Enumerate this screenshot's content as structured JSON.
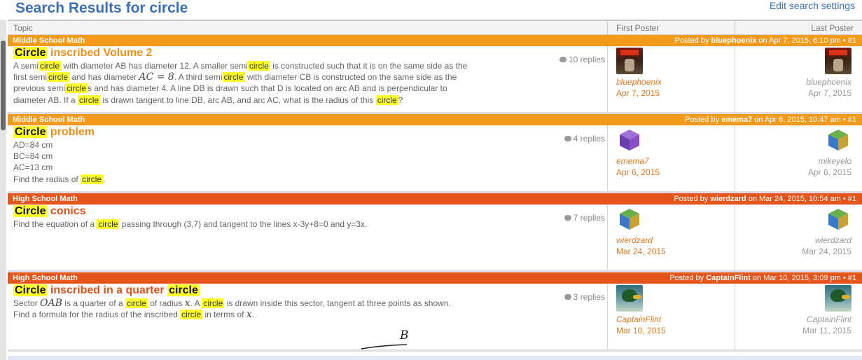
{
  "page": {
    "title": "Search Results for circle",
    "edit_link": "Edit search settings"
  },
  "columns": {
    "topic": "Topic",
    "first_poster": "First Poster",
    "last_poster": "Last Poster"
  },
  "colors": {
    "middle_school": "#f49a1b",
    "high_school": "#e5551b",
    "highlight": "#ffff2a",
    "link_blue": "#3a6fb5"
  },
  "threads": [
    {
      "forum": "Middle School Math",
      "posted_prefix": "Posted by ",
      "posted_user": "bluephoenix",
      "posted_suffix": " on Apr 7, 2015, 6:10 pm • #1",
      "title_kw": "Circle",
      "title_rest": " inscribed Volume 2",
      "replies": "10 replies",
      "excerpt": [
        [
          "A semi",
          "circle",
          " with diameter AB has diameter 12. A smaller semi",
          "circle",
          " is constructed such that it is on the same side as the"
        ],
        [
          "first semi",
          "circle",
          " and has diameter ",
          "AC = 8",
          ". A third semi",
          "circle",
          " with diameter CB is constructed on the same side as the"
        ],
        [
          "previous semi",
          "circle",
          "s and has diameter 4. A line DB is drawn such that D is located on arc AB and is perpendicular to"
        ],
        [
          "diameter AB. If a ",
          "circle",
          " is drawn tangent to line DB, arc AB, and arc AC, what is the radius of this ",
          "circle",
          "?"
        ]
      ],
      "first": {
        "user": "bluephoenix",
        "date": "Apr 7, 2015",
        "avatar": "doom-avatar"
      },
      "last": {
        "user": "bluephoenix",
        "date": "Apr 7, 2015",
        "avatar": "doom-avatar"
      }
    },
    {
      "forum": "Middle School Math",
      "posted_prefix": "Posted by ",
      "posted_user": "emema7",
      "posted_suffix": " on Apr 6, 2015, 10:47 am • #1",
      "title_kw": "Circle",
      "title_rest": " problem",
      "replies": "4 replies",
      "lines": [
        "AD=84 cm",
        "BC=84 cm",
        "AC=13 cm"
      ],
      "last_line_prefix": "Find the radius of ",
      "last_line_kw": "circle",
      "last_line_suffix": ".",
      "first": {
        "user": "emema7",
        "date": "Apr 6, 2015",
        "avatar": "purple-cube-avatar"
      },
      "last": {
        "user": "mikeyelo",
        "date": "Apr 6, 2015",
        "avatar": "multicolor-cube-avatar"
      }
    },
    {
      "forum": "High School Math",
      "posted_prefix": "Posted by ",
      "posted_user": "wierdzard",
      "posted_suffix": " on Mar 24, 2015, 10:54 am • #1",
      "title_kw": "Circle",
      "title_rest": " conics",
      "replies": "7 replies",
      "line_prefix": "Find the equation of a ",
      "line_kw": "circle",
      "line_suffix": " passing through (3,7) and tangent to the lines x-3y+8=0 and y=3x.",
      "first": {
        "user": "wierdzard",
        "date": "Mar 24, 2015",
        "avatar": "multicolor-cube-avatar"
      },
      "last": {
        "user": "wierdzard",
        "date": "Mar 24, 2015",
        "avatar": "multicolor-cube-avatar"
      }
    },
    {
      "forum": "High School Math",
      "posted_prefix": "Posted by ",
      "posted_user": "CaptainFlint",
      "posted_suffix": " on Mar 10, 2015, 3:09 pm • #1",
      "title_kw": "Circle",
      "title_mid": " inscribed in a quarter ",
      "title_kw2": "circle",
      "replies": "3 replies",
      "l1_a": "Sector ",
      "l1_math1": "OAB",
      "l1_b": " is a quarter of a ",
      "l1_kw": "circle",
      "l1_c": " of radius ",
      "l1_math2": "x",
      "l1_d": ". A ",
      "l1_kw2": "circle",
      "l1_e": " is drawn inside this sector, tangent at three points as shown.",
      "l2_a": "Find a formula for the radius of the inscribed ",
      "l2_kw": "circle",
      "l2_b": " in terms of ",
      "l2_math": "x",
      "l2_c": ".",
      "diagram_label": "B",
      "first": {
        "user": "CaptainFlint",
        "date": "Mar 10, 2015",
        "avatar": "duck-avatar"
      },
      "last": {
        "user": "CaptainFlint",
        "date": "Mar 11, 2015",
        "avatar": "duck-avatar"
      }
    }
  ]
}
